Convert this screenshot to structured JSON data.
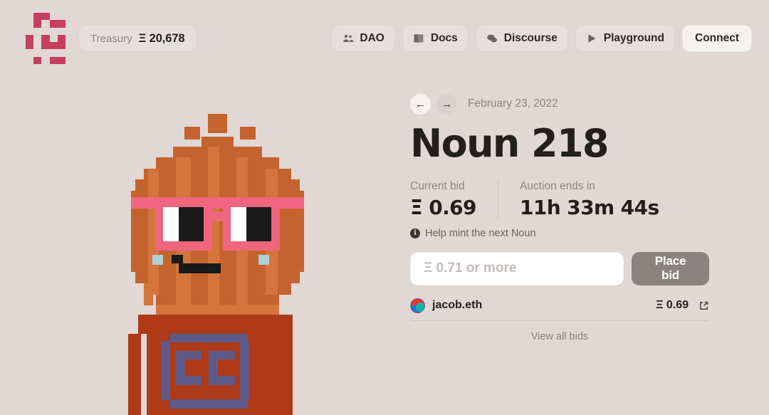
{
  "theme": {
    "background": "#e1d7d5",
    "text_dark": "#231f1f",
    "text_muted": "#8f8583",
    "accent_logo": "#c5405e",
    "button_grey": "#8c8381",
    "input_white": "#ffffff"
  },
  "header": {
    "logo_name": "nouns-logo",
    "treasury": {
      "label": "Treasury",
      "eth_symbol": "Ξ",
      "value": "20,678"
    },
    "nav": [
      {
        "label": "DAO",
        "icon": "people-icon",
        "glyph": "👥",
        "variant": "ghost"
      },
      {
        "label": "Docs",
        "icon": "book-icon",
        "glyph": "📖",
        "variant": "ghost"
      },
      {
        "label": "Discourse",
        "icon": "chat-bubbles-icon",
        "glyph": "💬",
        "variant": "ghost"
      },
      {
        "label": "Playground",
        "icon": "play-icon",
        "glyph": "▶",
        "variant": "ghost"
      },
      {
        "label": "Connect",
        "icon": "",
        "glyph": "",
        "variant": "solid"
      }
    ]
  },
  "auction": {
    "prev_arrow": "←",
    "next_arrow": "→",
    "date": "February 23, 2022",
    "title": "Noun 218",
    "current_bid": {
      "label": "Current bid",
      "value": "Ξ 0.69"
    },
    "ends_in": {
      "label": "Auction ends in",
      "value": "11h 33m 44s"
    },
    "help": {
      "icon_char": "i",
      "text": "Help mint the next Noun"
    },
    "bid_form": {
      "placeholder": "Ξ 0.71 or more",
      "value": "",
      "submit_label": "Place bid"
    },
    "bids": [
      {
        "avatar": "ens-avatar",
        "name": "jacob.eth",
        "amount": "Ξ 0.69",
        "link_icon": "external-link-icon"
      }
    ],
    "view_all_label": "View all bids"
  },
  "noun_art": {
    "name": "noun-218-artwork",
    "description": "Pixel art Noun: orange pumpkin-style head, pink square glasses, dark red body with purple glasses-case pattern",
    "colors": {
      "head_base": "#c5632f",
      "head_stripe": "#d4753c",
      "glasses_frame": "#f0657f",
      "glasses_white": "#ffffff",
      "glasses_black": "#1a1a1a",
      "body": "#ae3a18",
      "body_light": "#d4753c",
      "accent_purple": "#5d5a88",
      "cheek_blue": "#aecfd6"
    }
  }
}
